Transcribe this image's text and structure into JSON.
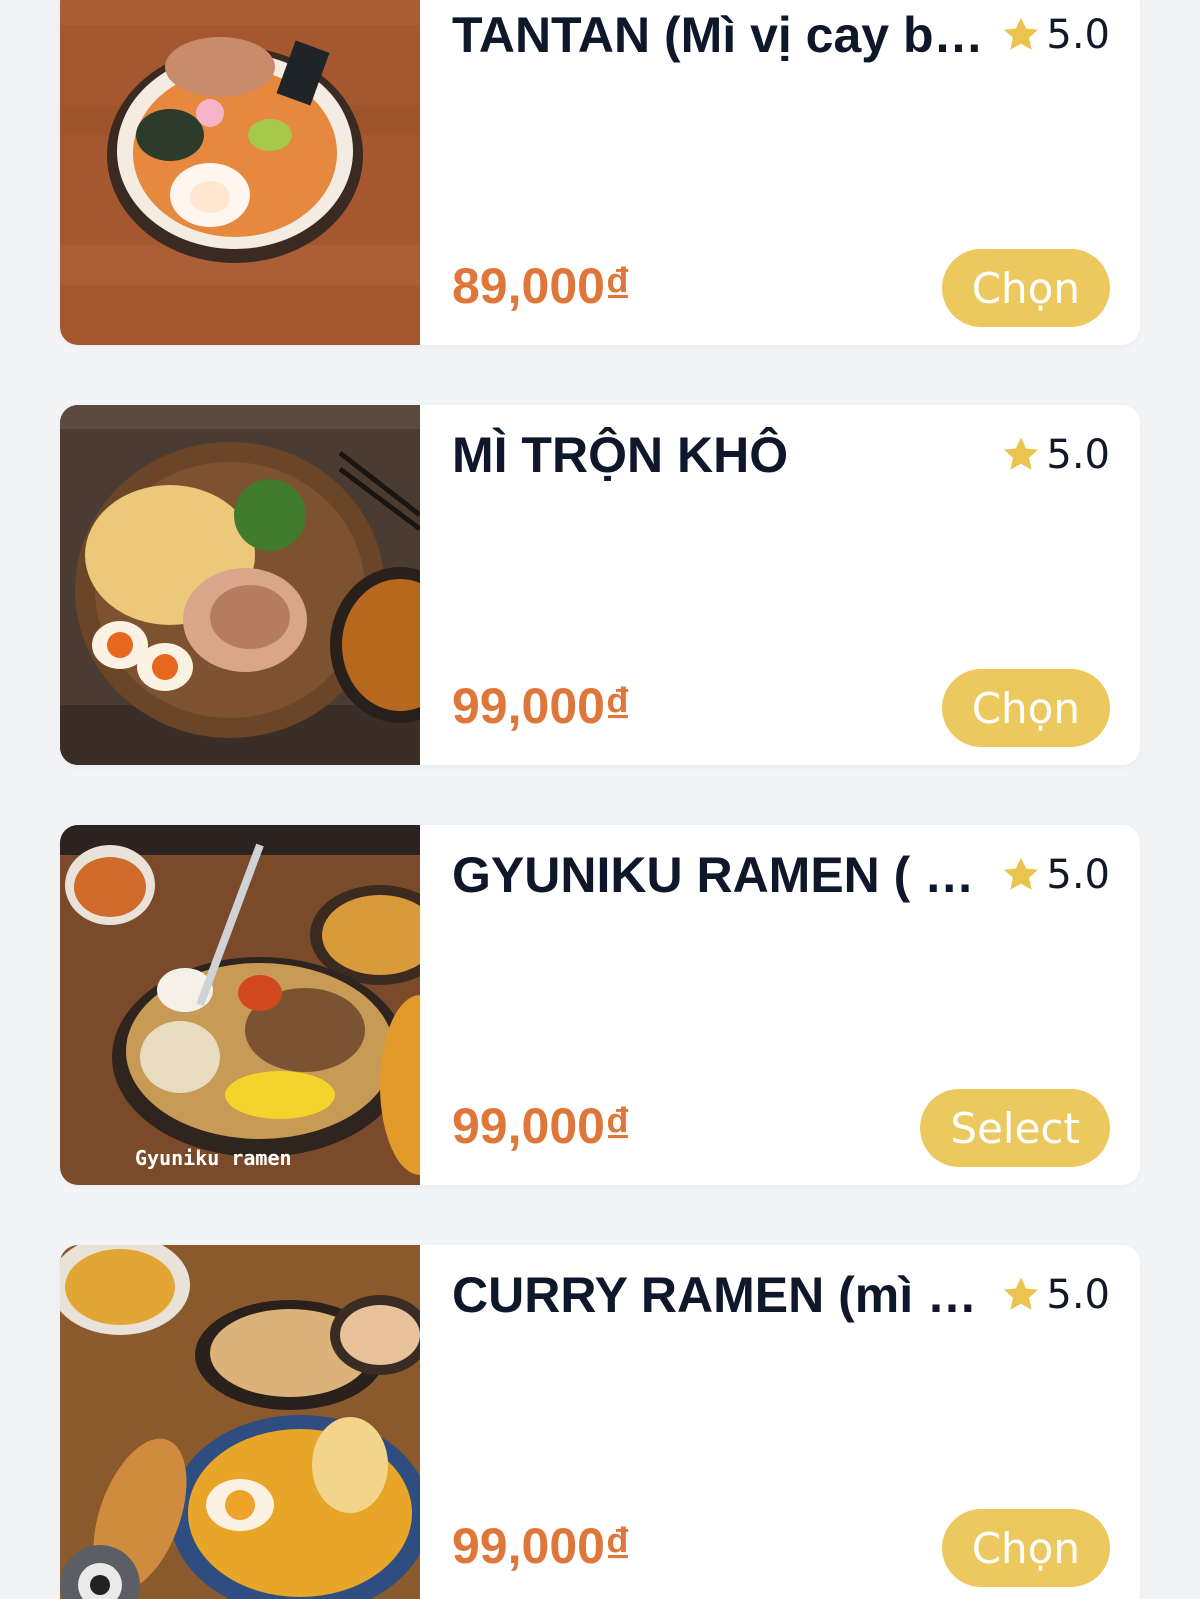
{
  "colors": {
    "page_bg": "#f3f4f6",
    "card_bg": "#ffffff",
    "title": "#0f172a",
    "price": "#e0773a",
    "button_bg": "#ecc95e",
    "button_text": "#ffffff",
    "star": "#eac44e"
  },
  "items": [
    {
      "name": "TANTAN (Mì vị cay béo)",
      "rating": "5.0",
      "rating_icon": "star-icon",
      "price": "89,000₫",
      "button_label": "Chọn"
    },
    {
      "name": "MÌ TRỘN KHÔ",
      "rating": "5.0",
      "rating_icon": "star-icon",
      "price": "99,000₫",
      "button_label": "Chọn"
    },
    {
      "name": "GYUNIKU RAMEN ( mì…",
      "rating": "5.0",
      "rating_icon": "star-icon",
      "price": "99,000₫",
      "button_label": "Select",
      "image_caption": "Gyuniku ramen"
    },
    {
      "name": "CURRY RAMEN (mì cà…",
      "rating": "5.0",
      "rating_icon": "star-icon",
      "price": "99,000₫",
      "button_label": "Chọn"
    }
  ]
}
